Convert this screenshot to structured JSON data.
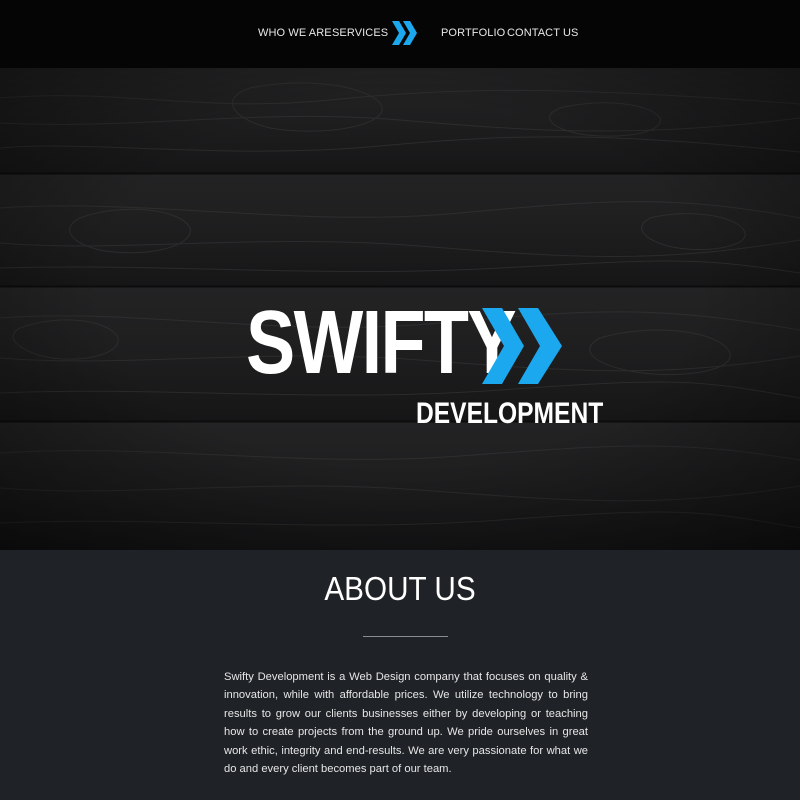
{
  "nav": {
    "items": [
      "WHO WE ARE",
      "SERVICES",
      "PORTFOLIO",
      "CONTACT US"
    ],
    "logo_icon": "double-chevron-icon"
  },
  "hero": {
    "title": "SWIFTY",
    "subtitle": "DEVELOPMENT",
    "logo_icon": "double-chevron-icon"
  },
  "about": {
    "heading": "ABOUT US",
    "body": "Swifty Development is a Web Design company that focuses on quality & innovation, while with affordable prices. We utilize technology to bring results to grow our clients businesses either by developing or teaching how to create projects from the ground up. We pride ourselves in great work ethic, integrity and end-results. We are very passionate for what we do and every client becomes part of our team."
  },
  "colors": {
    "accent": "#1ca8ee",
    "nav_bg": "#050505",
    "section_bg": "#1f2226",
    "text": "#ffffff"
  }
}
